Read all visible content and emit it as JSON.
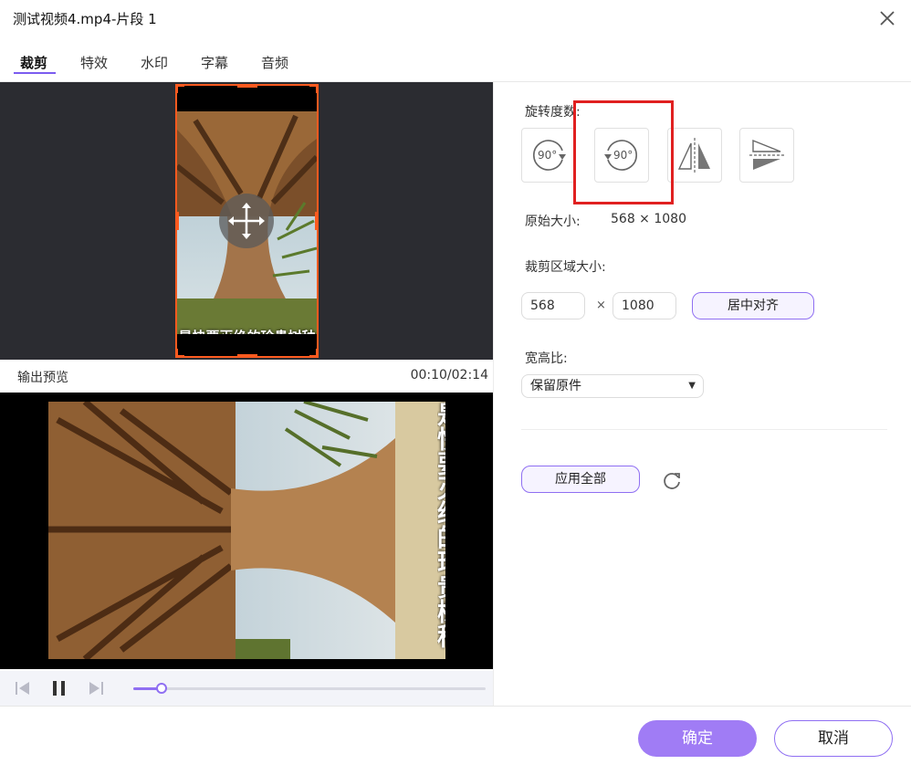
{
  "window": {
    "title": "测试视频4.mp4-片段 1"
  },
  "tabs": [
    {
      "label": "裁剪",
      "active": true
    },
    {
      "label": "特效"
    },
    {
      "label": "水印"
    },
    {
      "label": "字幕"
    },
    {
      "label": "音频"
    }
  ],
  "editor": {
    "subtitle": "是快要灭绝的珍贵树种"
  },
  "preview": {
    "label": "输出预览",
    "time": "00:10/02:14",
    "subtitle": "是快要灭绝的珍贵树种",
    "progress": 0.08
  },
  "rotation": {
    "label": "旋转度数:",
    "rotate_cw_text": "90°",
    "rotate_ccw_text": "90°"
  },
  "original_size": {
    "label": "原始大小:",
    "value": "568 × 1080"
  },
  "crop_area": {
    "label": "裁剪区域大小:",
    "width": "568",
    "times": "×",
    "height": "1080",
    "center_button": "居中对齐"
  },
  "aspect_ratio": {
    "label": "宽高比:",
    "selected": "保留原件"
  },
  "apply_all_button": "应用全部",
  "footer": {
    "ok": "确定",
    "cancel": "取消"
  },
  "colors": {
    "accent": "#8f6ff2",
    "crop_frame": "#ff5a1f",
    "highlight": "#e02020"
  }
}
